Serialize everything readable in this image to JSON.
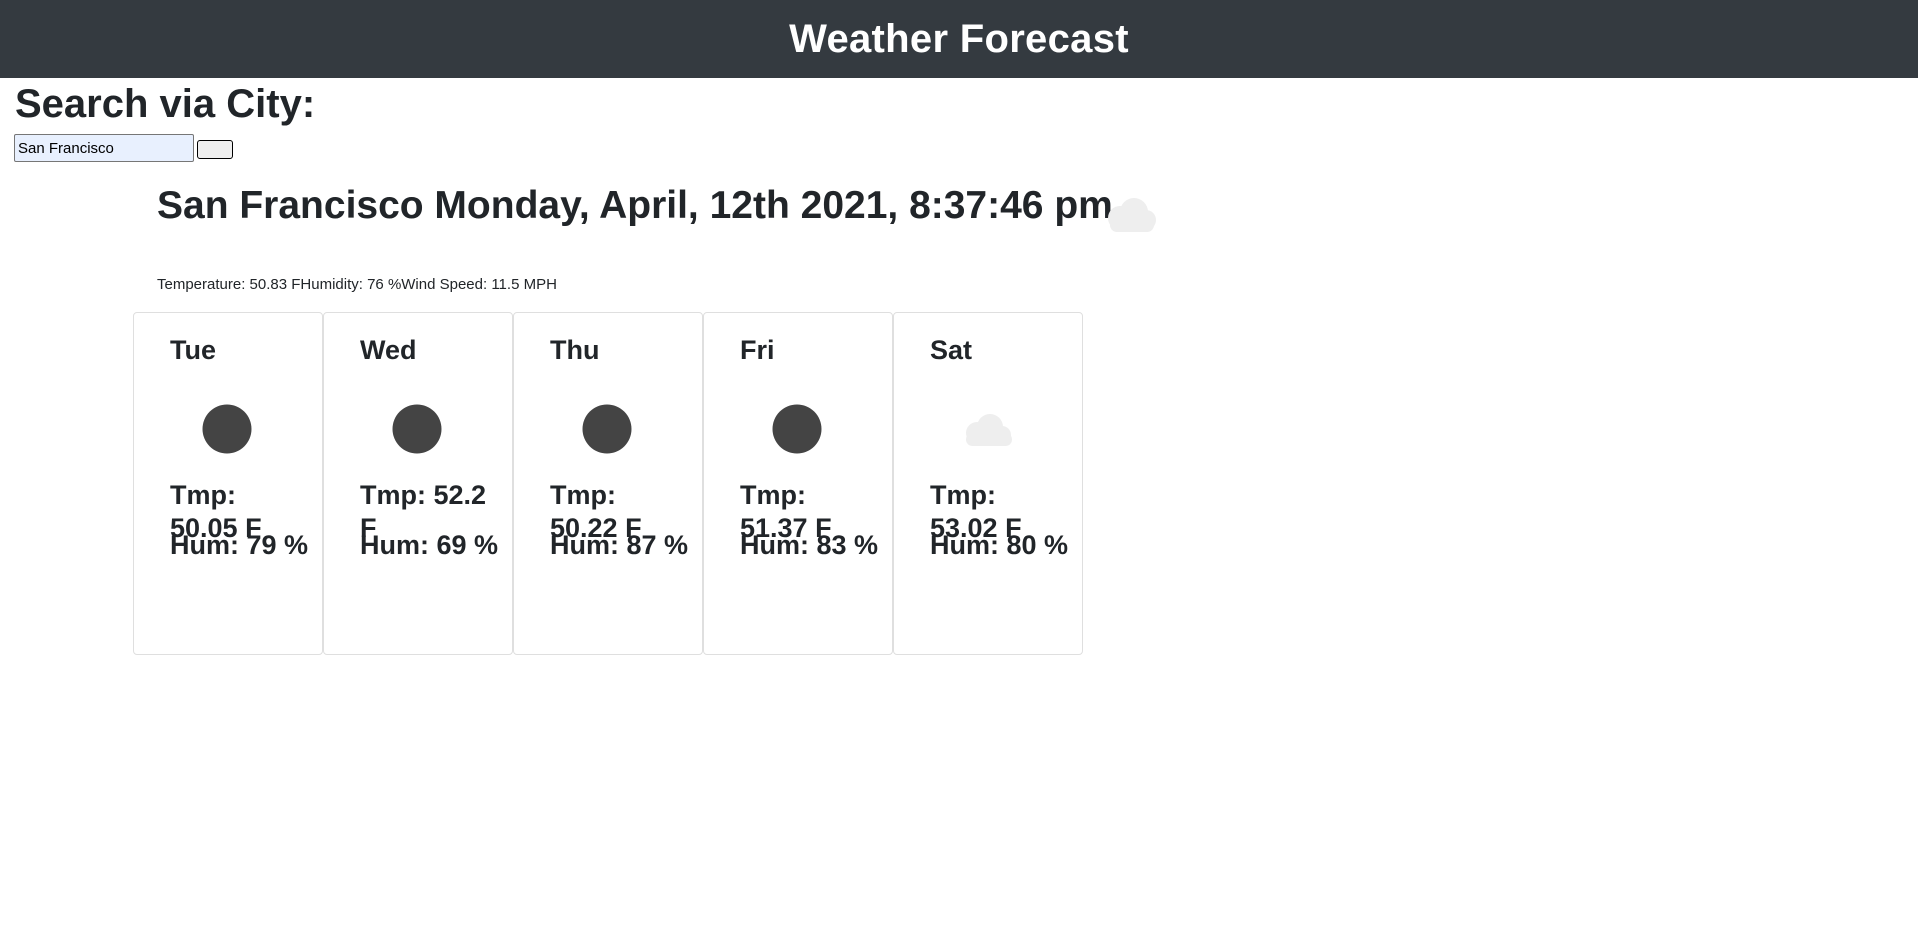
{
  "header": {
    "title": "Weather Forecast"
  },
  "search": {
    "heading": "Search via City:",
    "value": "San Francisco",
    "button_label": ""
  },
  "current": {
    "title": "San Francisco Monday, April, 12th 2021, 8:37:46 pm",
    "icon": "cloud-icon",
    "details": "Temperature: 50.83 FHumidity: 76 %Wind Speed: 11.5 MPH"
  },
  "forecast": [
    {
      "day": "Tue",
      "icon": "dark-circle-icon",
      "tmp": "Tmp: 50.05 F",
      "hum": "Hum: 79 %"
    },
    {
      "day": "Wed",
      "icon": "dark-circle-icon",
      "tmp": "Tmp: 52.2 F",
      "hum": "Hum: 69 %"
    },
    {
      "day": "Thu",
      "icon": "dark-circle-icon",
      "tmp": "Tmp: 50.22 F",
      "hum": "Hum: 87 %"
    },
    {
      "day": "Fri",
      "icon": "dark-circle-icon",
      "tmp": "Tmp: 51.37 F",
      "hum": "Hum: 83 %"
    },
    {
      "day": "Sat",
      "icon": "cloud-icon",
      "tmp": "Tmp: 53.02 F",
      "hum": "Hum: 80 %"
    }
  ],
  "colors": {
    "header_bg": "#343a40",
    "header_text": "#ffffff",
    "text": "#212529",
    "dark_icon": "#444444",
    "cloud_icon": "#eeeeee"
  }
}
